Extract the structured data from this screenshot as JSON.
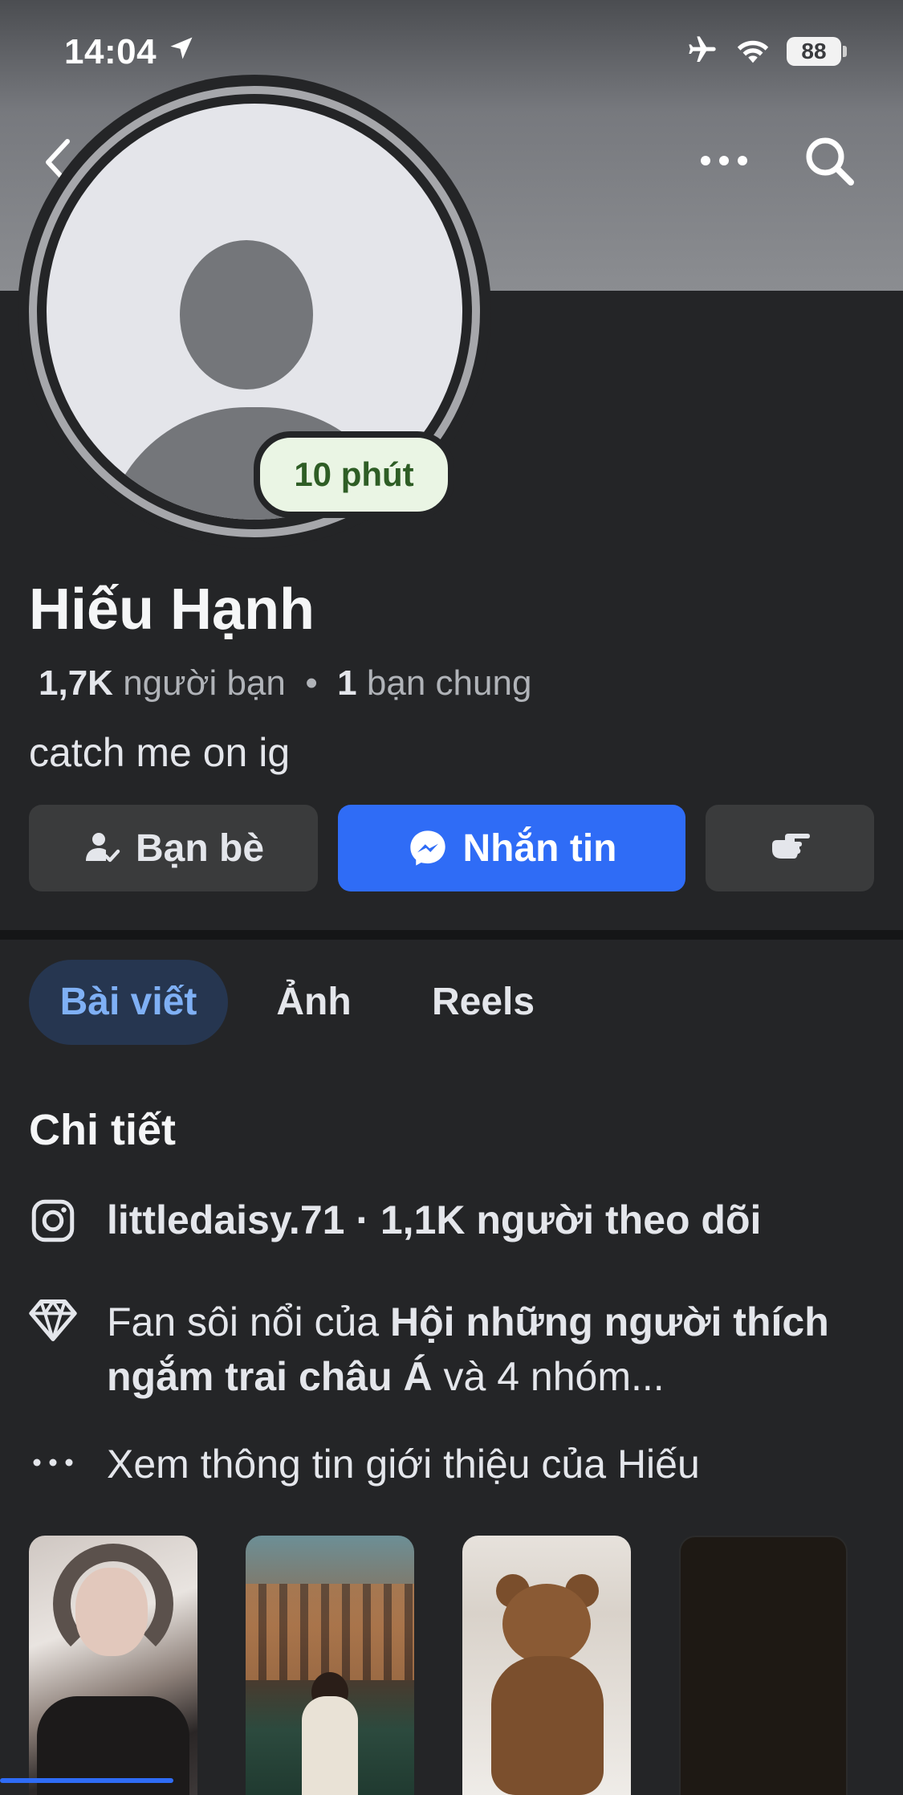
{
  "status_bar": {
    "time": "14:04",
    "battery": "88"
  },
  "profile": {
    "status_label": "10 phút",
    "name": "Hiếu Hạnh",
    "friends_count": "1,7K",
    "friends_label": "người bạn",
    "separator": "•",
    "mutual_count": "1",
    "mutual_label": "bạn chung",
    "bio": "catch me on ig"
  },
  "actions": {
    "friends_label": "Bạn bè",
    "message_label": "Nhắn tin"
  },
  "tabs": [
    {
      "label": "Bài viết",
      "active": true
    },
    {
      "label": "Ảnh",
      "active": false
    },
    {
      "label": "Reels",
      "active": false
    }
  ],
  "details": {
    "title": "Chi tiết",
    "instagram": "littledaisy.71 · 1,1K người theo dõi",
    "fan_prefix": "Fan sôi nổi của ",
    "fan_group": "Hội những người thích ngắm trai châu Á",
    "fan_suffix": " và 4 nhóm...",
    "about": "Xem thông tin giới thiệu của Hiếu"
  },
  "colors": {
    "background": "#242527",
    "accent": "#2f6cf6",
    "active_tab_bg": "#263650",
    "active_tab_text": "#7fb0f5",
    "status_pill_bg": "#eaf5e4",
    "status_pill_text": "#2e5d25"
  },
  "icons": {
    "back": "chevron-left-icon",
    "more": "more-icon",
    "search": "search-icon",
    "friends": "friend-check-icon",
    "messenger": "messenger-icon",
    "poke": "poke-icon",
    "instagram": "instagram-icon",
    "diamond": "diamond-icon",
    "dots": "more-horizontal-icon"
  }
}
